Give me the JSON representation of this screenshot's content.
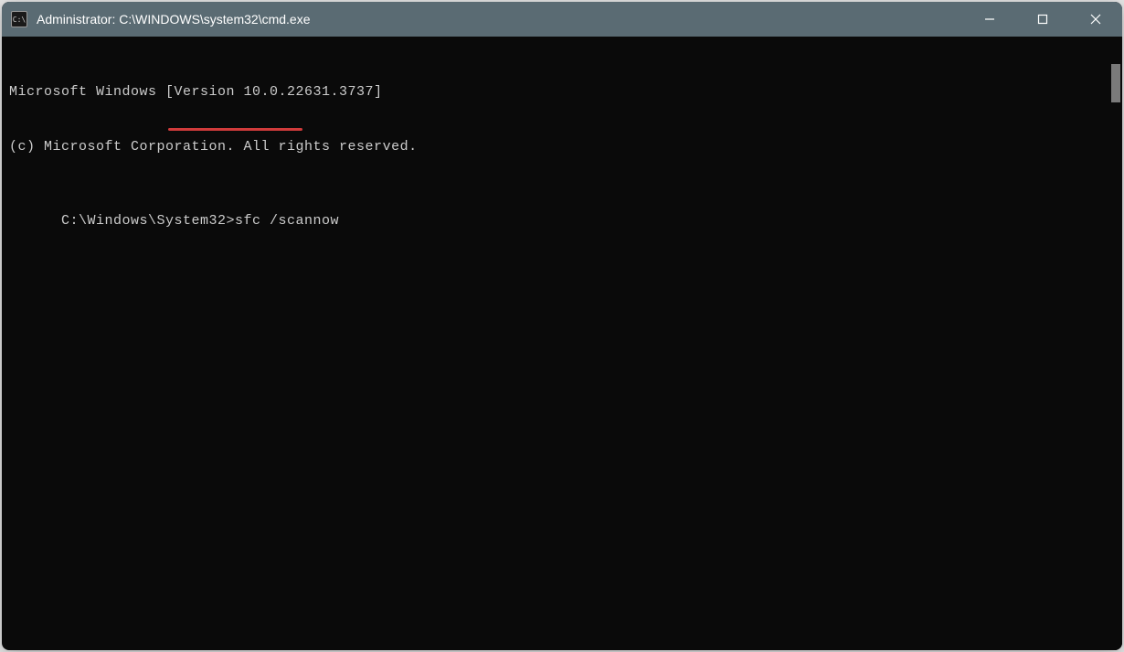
{
  "window": {
    "title": "Administrator: C:\\WINDOWS\\system32\\cmd.exe",
    "icon_label": "C:\\"
  },
  "terminal": {
    "lines": [
      "Microsoft Windows [Version 10.0.22631.3737]",
      "(c) Microsoft Corporation. All rights reserved.",
      "",
      "C:\\Windows\\System32>sfc /scannow"
    ],
    "prompt": "C:\\Windows\\System32>",
    "command": "sfc /scannow"
  },
  "annotation": {
    "underline_target": "sfc /scannow",
    "underline_color": "#d13b3b"
  }
}
